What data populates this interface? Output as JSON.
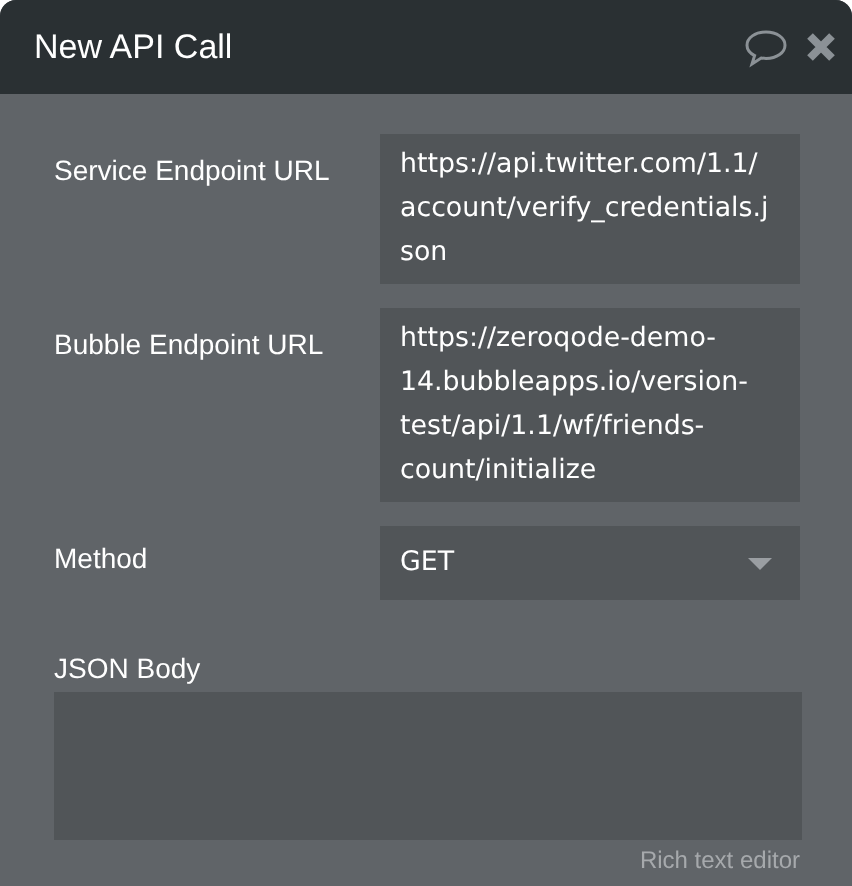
{
  "window": {
    "title": "New API Call"
  },
  "fields": [
    {
      "kind": "text",
      "label": "Service Endpoint URL",
      "value": "https://api.twitter.com/1.1/account/verify_credentials.json"
    },
    {
      "kind": "text",
      "label": "Bubble Endpoint URL",
      "value": "https://zeroqode-demo-14.bubbleapps.io/version-test/api/1.1/wf/friends-count/initialize"
    },
    {
      "kind": "select",
      "label": "Method",
      "value": "GET"
    },
    {
      "kind": "textarea",
      "label": "JSON Body",
      "hint": "Rich text editor"
    }
  ]
}
